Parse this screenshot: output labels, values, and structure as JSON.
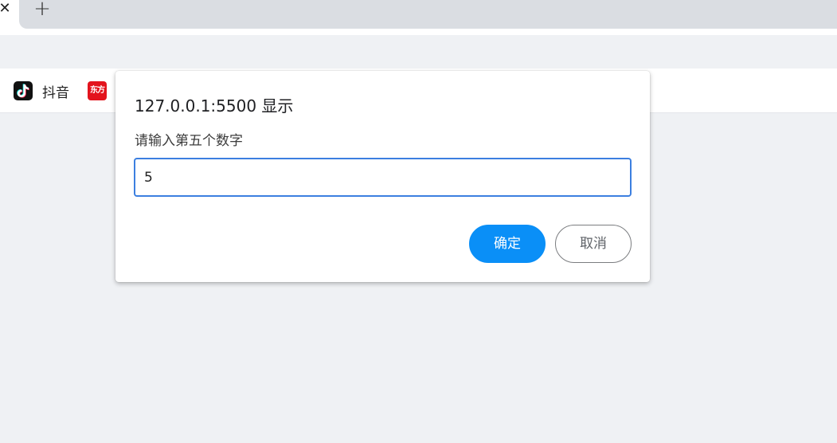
{
  "tabs": {
    "close_glyph": "✕",
    "new_tab_glyph": "+"
  },
  "bookmarks": [
    {
      "label": "抖音",
      "icon": "douyin-icon"
    },
    {
      "label": "",
      "icon_text": "东方",
      "icon": "dongfang-icon"
    }
  ],
  "dialog": {
    "title": "127.0.0.1:5500 显示",
    "message": "请输入第五个数字",
    "input_value": "5",
    "ok_label": "确定",
    "cancel_label": "取消"
  },
  "colors": {
    "accent": "#0a8ff7",
    "input_focus": "#3c7fe0"
  }
}
